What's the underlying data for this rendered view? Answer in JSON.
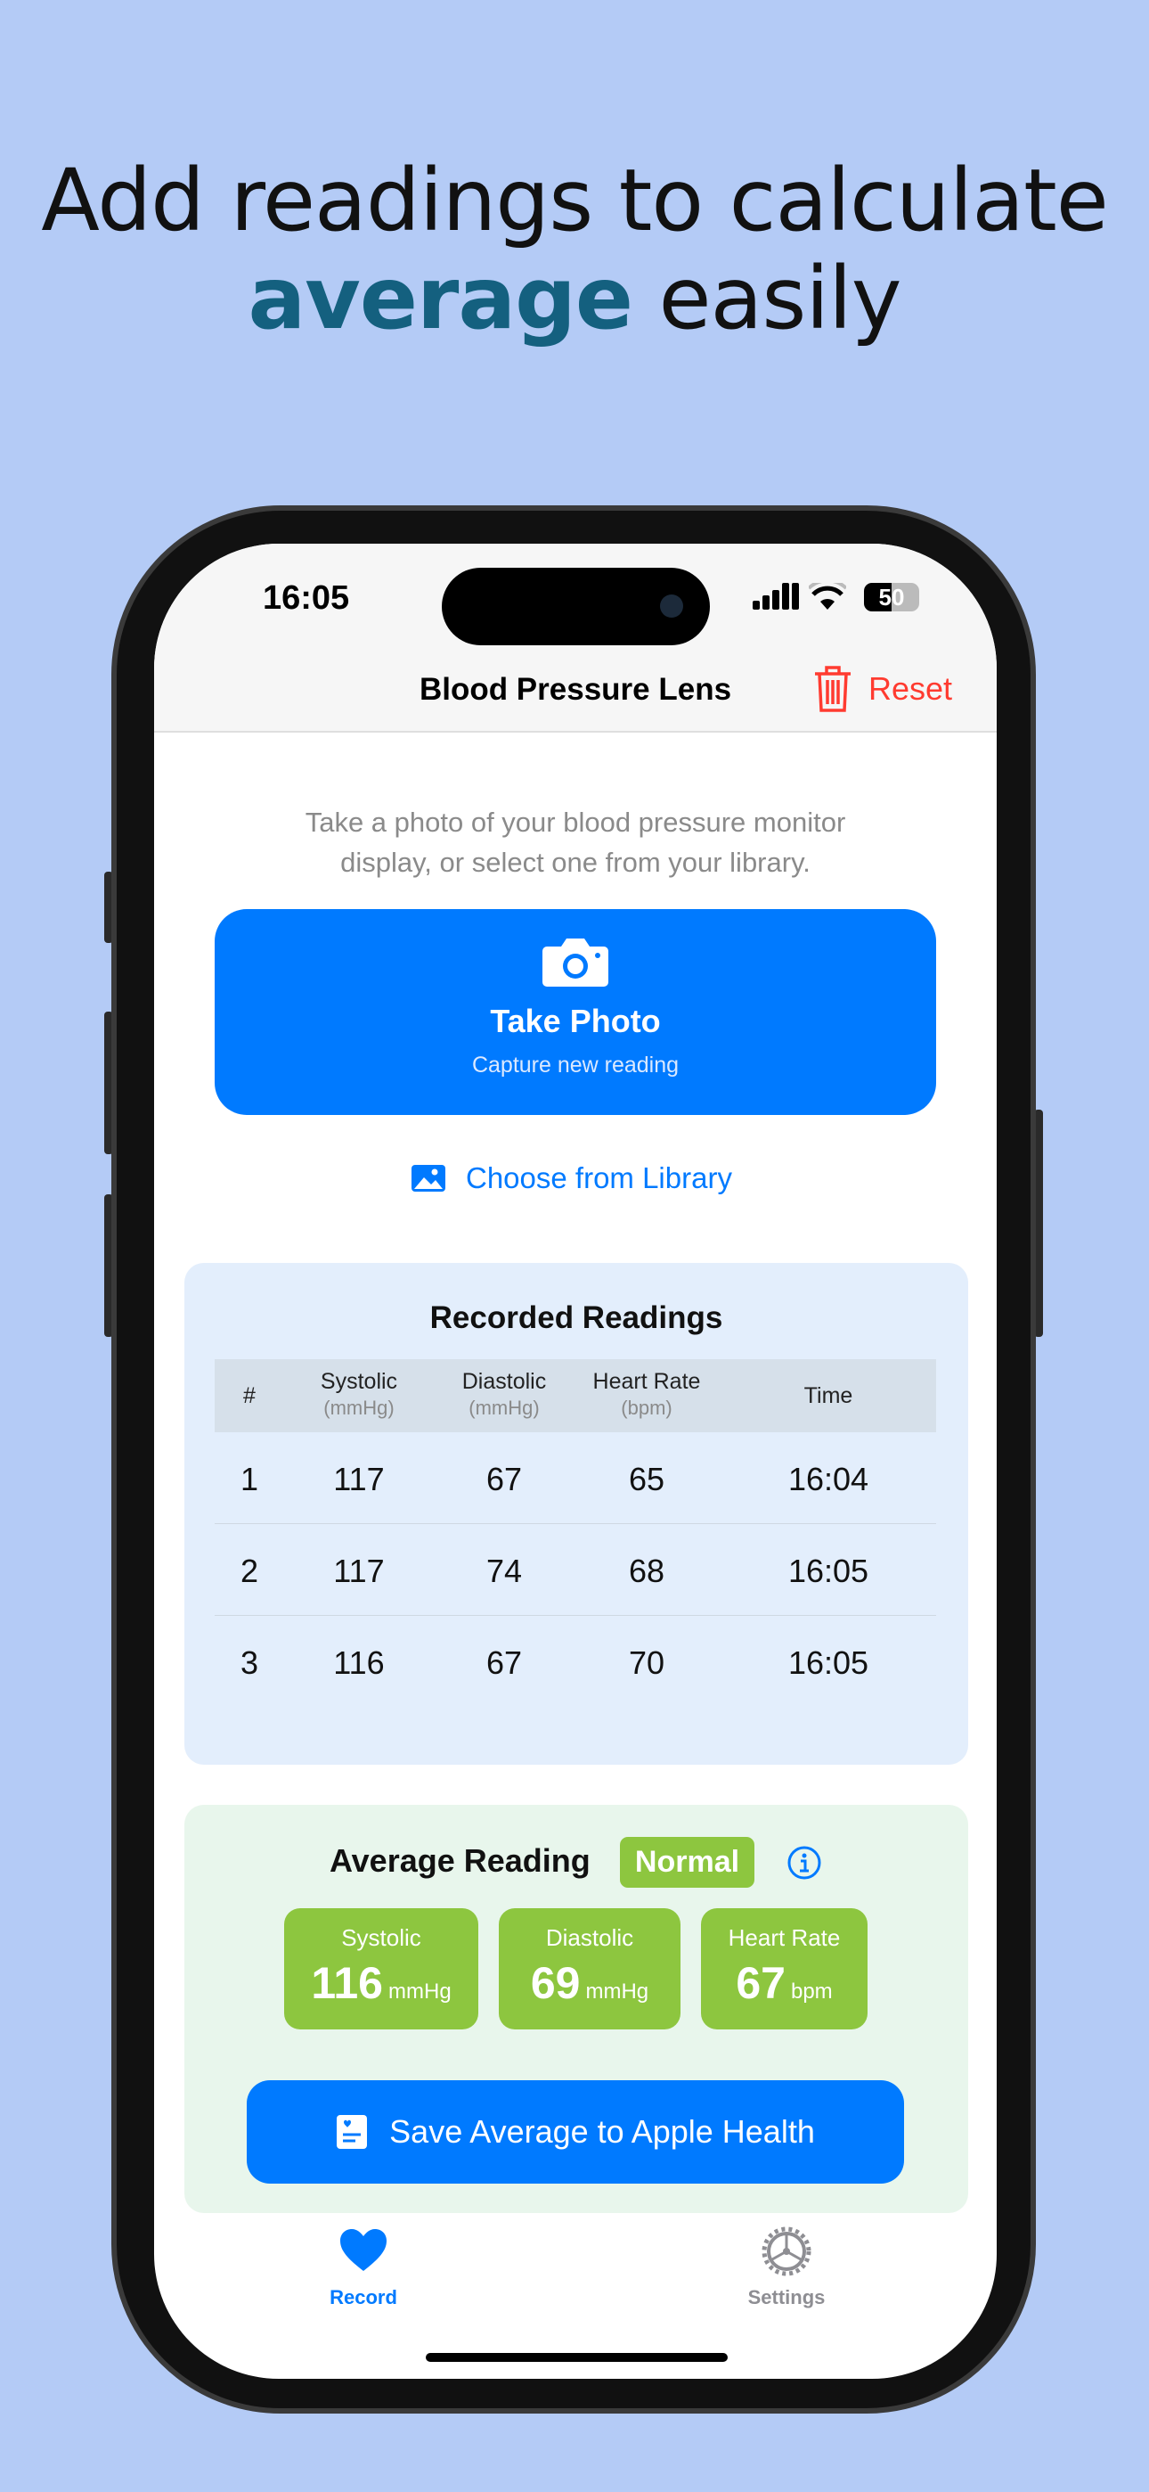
{
  "headline": {
    "line1": "Add readings to calculate",
    "highlight": "average",
    "rest": " easily"
  },
  "status_bar": {
    "time": "16:05",
    "battery": "50"
  },
  "nav": {
    "title": "Blood Pressure Lens",
    "reset_label": "Reset",
    "reset_icon": "trash-icon"
  },
  "instructions": {
    "line1": "Take a photo of your blood pressure monitor",
    "line2": "display, or select one from your library."
  },
  "take_photo": {
    "label": "Take Photo",
    "sublabel": "Capture new reading",
    "icon": "camera-icon"
  },
  "library": {
    "label": "Choose from Library",
    "icon": "photo-icon"
  },
  "readings": {
    "title": "Recorded Readings",
    "headers": [
      {
        "label": "#",
        "unit": ""
      },
      {
        "label": "Systolic",
        "unit": "(mmHg)"
      },
      {
        "label": "Diastolic",
        "unit": "(mmHg)"
      },
      {
        "label": "Heart Rate",
        "unit": "(bpm)"
      },
      {
        "label": "Time",
        "unit": ""
      }
    ],
    "rows": [
      [
        "1",
        "117",
        "67",
        "65",
        "16:04"
      ],
      [
        "2",
        "117",
        "74",
        "68",
        "16:05"
      ],
      [
        "3",
        "116",
        "67",
        "70",
        "16:05"
      ]
    ]
  },
  "average": {
    "title": "Average Reading",
    "status": "Normal",
    "status_color": "#8dc63f",
    "tiles": [
      {
        "label": "Systolic",
        "value": "116",
        "unit": "mmHg"
      },
      {
        "label": "Diastolic",
        "value": "69",
        "unit": "mmHg"
      },
      {
        "label": "Heart Rate",
        "value": "67",
        "unit": "bpm"
      }
    ],
    "save_label": "Save Average to Apple Health"
  },
  "tabs": [
    {
      "label": "Record",
      "icon": "heart-icon",
      "active": true
    },
    {
      "label": "Settings",
      "icon": "gear-icon",
      "active": false
    }
  ],
  "colors": {
    "accent": "#007aff",
    "danger": "#ff3b30",
    "headline_accent": "#14607f"
  }
}
